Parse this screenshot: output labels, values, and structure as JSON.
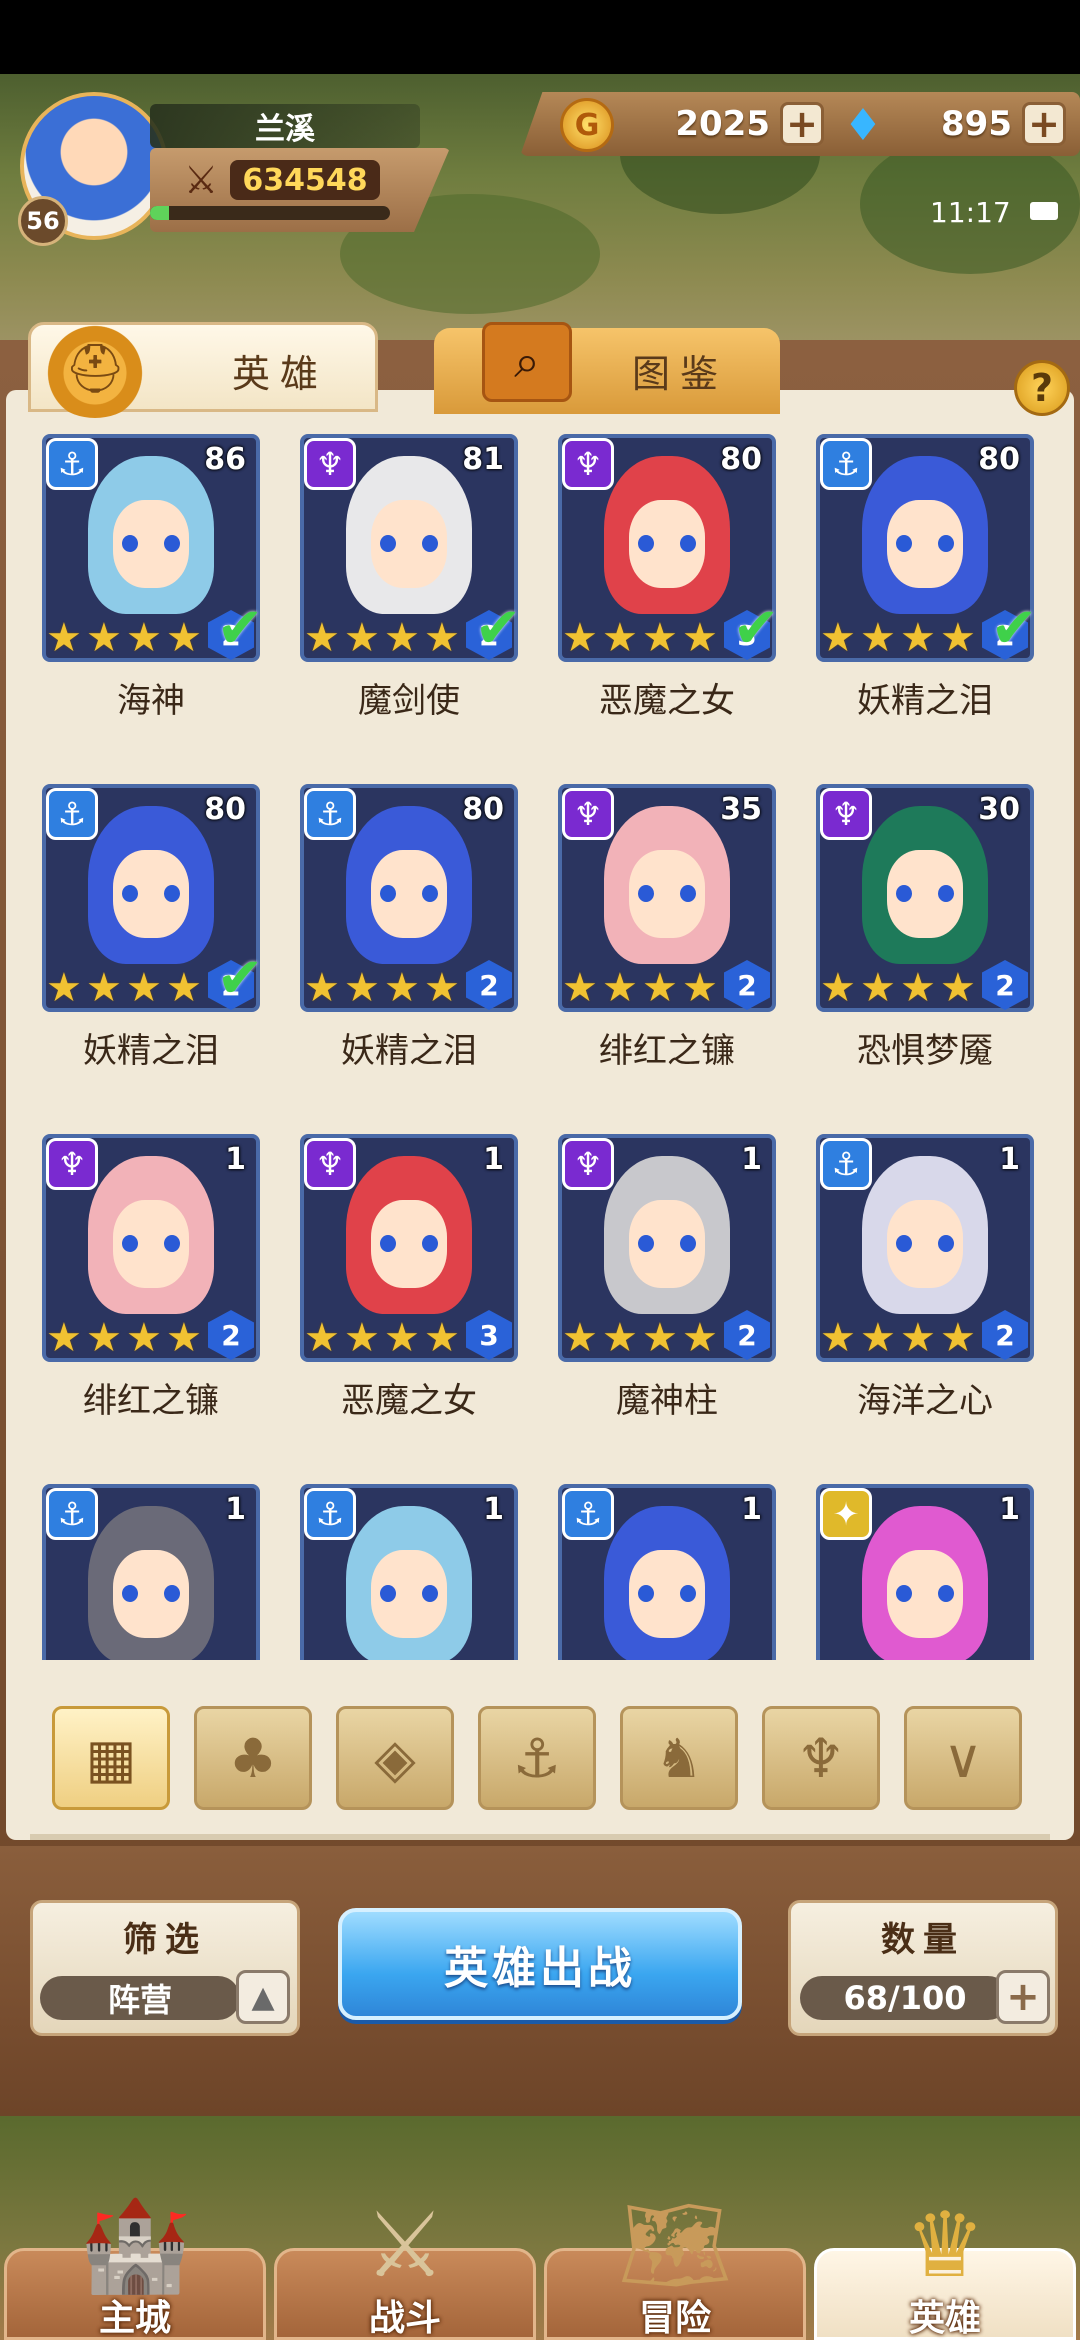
{
  "player": {
    "name": "兰溪",
    "level": "56",
    "power": "634548",
    "xp_fraction": 0.08
  },
  "currency": {
    "gold": "2025",
    "gems": "895",
    "plus": "+"
  },
  "status": {
    "time": "11:17"
  },
  "tabs": [
    {
      "label": "英雄",
      "active": true
    },
    {
      "label": "图鉴",
      "active": false
    }
  ],
  "help": "?",
  "heroes": [
    {
      "name": "海神",
      "level": "86",
      "faction": "anchor",
      "stars": 4,
      "rank": "2",
      "checked": true,
      "hair": "#8ecbe8"
    },
    {
      "name": "魔剑使",
      "level": "81",
      "faction": "demon",
      "stars": 4,
      "rank": "2",
      "checked": true,
      "hair": "#e8e8ea"
    },
    {
      "name": "恶魔之女",
      "level": "80",
      "faction": "demon",
      "stars": 4,
      "rank": "3",
      "checked": true,
      "hair": "#e0424a"
    },
    {
      "name": "妖精之泪",
      "level": "80",
      "faction": "anchor",
      "stars": 4,
      "rank": "2",
      "checked": true,
      "hair": "#3a5ad8"
    },
    {
      "name": "妖精之泪",
      "level": "80",
      "faction": "anchor",
      "stars": 4,
      "rank": "2",
      "checked": true,
      "hair": "#3a5ad8"
    },
    {
      "name": "妖精之泪",
      "level": "80",
      "faction": "anchor",
      "stars": 4,
      "rank": "2",
      "checked": false,
      "hair": "#3a5ad8"
    },
    {
      "name": "绯红之镰",
      "level": "35",
      "faction": "demon",
      "stars": 4,
      "rank": "2",
      "checked": false,
      "hair": "#f2b2b8"
    },
    {
      "name": "恐惧梦魇",
      "level": "30",
      "faction": "demon",
      "stars": 4,
      "rank": "2",
      "checked": false,
      "hair": "#1e7a5a"
    },
    {
      "name": "绯红之镰",
      "level": "1",
      "faction": "demon",
      "stars": 4,
      "rank": "2",
      "checked": false,
      "hair": "#f2b2b8"
    },
    {
      "name": "恶魔之女",
      "level": "1",
      "faction": "demon",
      "stars": 4,
      "rank": "3",
      "checked": false,
      "hair": "#e0424a"
    },
    {
      "name": "魔神柱",
      "level": "1",
      "faction": "demon",
      "stars": 4,
      "rank": "2",
      "checked": false,
      "hair": "#c8c8cc"
    },
    {
      "name": "海洋之心",
      "level": "1",
      "faction": "anchor",
      "stars": 4,
      "rank": "2",
      "checked": false,
      "hair": "#d8d8ea"
    },
    {
      "name": "",
      "level": "1",
      "faction": "anchor",
      "stars": 0,
      "rank": "",
      "checked": false,
      "hair": "#6a6a78"
    },
    {
      "name": "",
      "level": "1",
      "faction": "anchor",
      "stars": 0,
      "rank": "",
      "checked": false,
      "hair": "#8ecbe8"
    },
    {
      "name": "",
      "level": "1",
      "faction": "anchor",
      "stars": 0,
      "rank": "",
      "checked": false,
      "hair": "#3a5ad8"
    },
    {
      "name": "",
      "level": "1",
      "faction": "light",
      "stars": 0,
      "rank": "",
      "checked": false,
      "hair": "#e05ad0"
    }
  ],
  "faction_filters": [
    {
      "icon": "grid-icon",
      "active": true
    },
    {
      "icon": "leaf-icon",
      "active": false
    },
    {
      "icon": "diamond-icon",
      "active": false
    },
    {
      "icon": "anchor-icon",
      "active": false
    },
    {
      "icon": "beast-icon",
      "active": false
    },
    {
      "icon": "demon-icon",
      "active": false
    },
    {
      "icon": "wing-icon",
      "active": false
    }
  ],
  "filter_box": {
    "title": "筛选",
    "value": "阵营"
  },
  "deploy_label": "英雄出战",
  "count_box": {
    "title": "数量",
    "value": "68/100"
  },
  "nav": [
    {
      "label": "主城",
      "icon": "castle-icon",
      "active": false
    },
    {
      "label": "战斗",
      "icon": "swords-icon",
      "active": false
    },
    {
      "label": "冒险",
      "icon": "map-icon",
      "active": false
    },
    {
      "label": "英雄",
      "icon": "crest-icon",
      "active": true
    }
  ],
  "colors": {
    "accent_blue": "#3aa6f0",
    "anchor": "#2f7fe0",
    "demon": "#7a2ad0",
    "light": "#e0b92a",
    "check": "#3fd14a"
  }
}
